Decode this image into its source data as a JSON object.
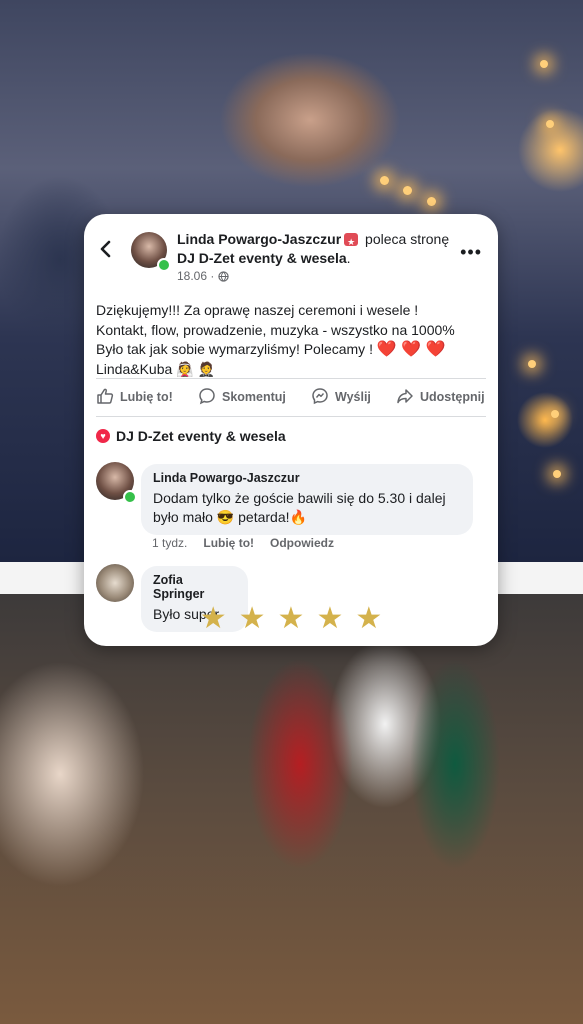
{
  "post": {
    "author_name": "Linda Powargo-Jaszczur",
    "action_text": "poleca stronę",
    "page_name": "DJ D-Zet eventy & wesela",
    "date": "18.06 ·",
    "body_line1": "Dziękujęmy!!! Za oprawę naszej ceremoni i wesele !",
    "body_line2": "Kontakt, flow, prowadzenie, muzyka - wszystko na 1000%",
    "body_line3": "Było tak jak sobie wymarzyliśmy! Polecamy !",
    "body_line4": "Linda&Kuba",
    "hearts": "❤️ ❤️ ❤️"
  },
  "actions": {
    "like": "Lubię to!",
    "comment": "Skomentuj",
    "send": "Wyślij",
    "share": "Udostępnij"
  },
  "page_line": "DJ D-Zet eventy & wesela",
  "comments": [
    {
      "author": "Linda Powargo-Jaszczur",
      "text_line1": "Dodam tylko że goście bawili się do 5.30 i dalej",
      "text_line2": "było mało 😎 petarda!🔥",
      "time": "1 tydz.",
      "like": "Lubię to!",
      "reply": "Odpowiedz"
    },
    {
      "author": "Zofia Springer",
      "text_line1": "Było super"
    }
  ],
  "rating": {
    "value": 5,
    "max": 5
  },
  "colors": {
    "accent": "#d4b24c",
    "facebook_grey": "#65676b",
    "bubble": "#f0f2f5"
  }
}
